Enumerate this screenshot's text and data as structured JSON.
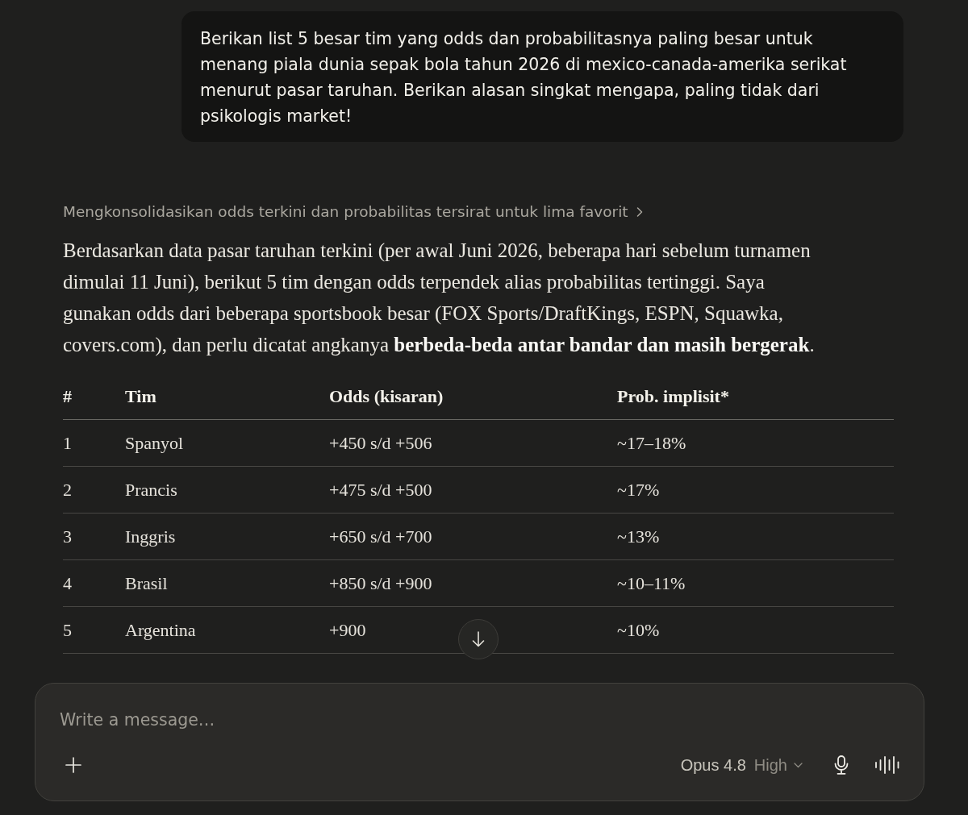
{
  "user_message": {
    "text": "Berikan list 5 besar tim yang odds dan probabilitasnya paling besar untuk menang piala dunia sepak bola tahun 2026 di mexico-canada-amerika serikat menurut pasar taruhan. Berikan alasan singkat mengapa, paling tidak dari psikologis market!"
  },
  "thinking": {
    "label": "Mengkonsolidasikan odds terkini dan probabilitas tersirat untuk lima favorit",
    "expanded": false
  },
  "response": {
    "paragraph": "Berdasarkan data pasar taruhan terkini (per awal Juni 2026, beberapa hari sebelum turnamen dimulai 11 Juni), berikut 5 tim dengan odds terpendek alias probabilitas tertinggi. Saya gunakan odds dari beberapa sportsbook besar (FOX Sports/DraftKings, ESPN, Squawka, covers.com), dan perlu dicatat angkanya **berbeda-beda antar bandar dan masih bergerak**.",
    "table": {
      "columns": [
        "#",
        "Tim",
        "Odds (kisaran)",
        "Prob. implisit*"
      ],
      "rows": [
        [
          "1",
          "Spanyol",
          "+450 s/d +506",
          "~17–18%"
        ],
        [
          "2",
          "Prancis",
          "+475 s/d +500",
          "~17%"
        ],
        [
          "3",
          "Inggris",
          "+650 s/d +700",
          "~13%"
        ],
        [
          "4",
          "Brasil",
          "+850 s/d +900",
          "~10–11%"
        ],
        [
          "5",
          "Argentina",
          "+900",
          "~10%"
        ]
      ]
    }
  },
  "composer": {
    "placeholder": "Write a message…",
    "model": "Opus 4.8",
    "effort": "High"
  }
}
